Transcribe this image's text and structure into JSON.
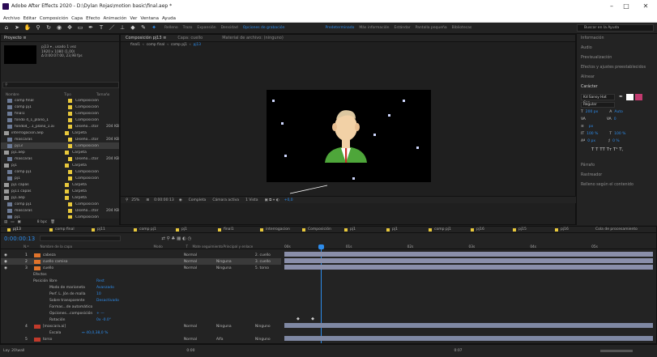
{
  "window": {
    "title": "Adobe After Effects 2020 - D:\\Dylan Rojas\\motion basic\\final.aep *",
    "minimize": "–",
    "maximize": "□",
    "close": "✕"
  },
  "menu": [
    "Archivo",
    "Editar",
    "Composición",
    "Capa",
    "Efecto",
    "Animación",
    "Ver",
    "Ventana",
    "Ayuda"
  ],
  "toolbar": {
    "items": [
      "Relleno",
      "Trazo",
      "Expansión",
      "Densidad",
      "Opciones de grabación",
      "Predeterminado",
      "Más información",
      "Estándar",
      "Pantalla pequeña",
      "Bibliotecas"
    ],
    "search_placeholder": "Buscar en la Ayuda"
  },
  "project": {
    "tab": "Proyecto ≡",
    "thumb_info": [
      "pj13 ▾ , usado 1 vez",
      "1920 x 1080 (1,00)",
      "Δ 0:00:07:00, 23,98 fps"
    ],
    "search_placeholder": "",
    "headers": [
      "Nombre",
      "Tipo",
      "Tamaño"
    ],
    "items": [
      {
        "name": "comp final",
        "type": "Composición",
        "size": "",
        "sel": false
      },
      {
        "name": "comp pj1",
        "type": "Composición",
        "size": "",
        "sel": false
      },
      {
        "name": "final1",
        "type": "Composición",
        "size": "",
        "sel": false
      },
      {
        "name": "fondo 4_1_plano_1",
        "type": "Composición",
        "size": "",
        "sel": false
      },
      {
        "name": "fondo4_..1_plano_1.ai",
        "type": "Diseño...ctor",
        "size": "204 KB",
        "sel": false
      },
      {
        "name": "interrogacion.aep",
        "type": "Carpeta",
        "size": "",
        "sel": false
      },
      {
        "name": "mascaras",
        "type": "Diseño...ctor",
        "size": "204 KB",
        "sel": false
      },
      {
        "name": "pj13",
        "type": "Composición",
        "size": "",
        "sel": true
      },
      {
        "name": "pj1.aep",
        "type": "Carpeta",
        "size": "",
        "sel": false
      },
      {
        "name": "mascaras",
        "type": "Diseño...ctor",
        "size": "204 KB",
        "sel": false
      },
      {
        "name": "pj1",
        "type": "Carpeta",
        "size": "",
        "sel": false
      },
      {
        "name": "comp pj1",
        "type": "Composición",
        "size": "",
        "sel": false
      },
      {
        "name": "pj1",
        "type": "Composición",
        "size": "",
        "sel": false
      },
      {
        "name": "pj1 capas",
        "type": "Carpeta",
        "size": "",
        "sel": false
      },
      {
        "name": "pj11 capas",
        "type": "Carpeta",
        "size": "",
        "sel": false
      },
      {
        "name": "pj1.aep",
        "type": "Carpeta",
        "size": "",
        "sel": false
      },
      {
        "name": "comp pj1",
        "type": "Composición",
        "size": "",
        "sel": false
      },
      {
        "name": "mascaras",
        "type": "Diseño...ctor",
        "size": "204 KB",
        "sel": false
      },
      {
        "name": "pj1",
        "type": "Composición",
        "size": "",
        "sel": false
      }
    ],
    "bit_depth": "8 bpc"
  },
  "composition": {
    "tab": "Composición pj13 ≡",
    "layer_tab": "Capa: cuello",
    "material": "Material de archivo: (ninguno)",
    "breadcrumbs": [
      "final1",
      "comp final",
      "comp pj1",
      "pj13"
    ],
    "zoom": "25%",
    "timecode": "0:00:00:13",
    "quality": "Completa",
    "camera": "Cámara activa",
    "views": "1 Vista",
    "offset": "+0,0"
  },
  "right_panel": {
    "items": [
      "Información",
      "Audio",
      "Previsualización",
      "Efectos y ajustes preestablecidos",
      "Alinear"
    ],
    "char_title": "Carácter",
    "font": "Kd Sansy Hat Con...",
    "style": "Regular",
    "size": "200 px",
    "leading": "Auto",
    "tracking": "0",
    "units": "px",
    "vscale": "100 %",
    "hscale": "100 %",
    "baseline": "0 px",
    "tsume": "0 %",
    "styles_text": "T  T  TT  Tт  T¹  T,",
    "after": [
      "Párrafo",
      "Rastreador",
      "Relleno según el contenido"
    ]
  },
  "timeline": {
    "tabs": [
      "pj13",
      "comp final",
      "pj11",
      "comp pj1",
      "pj1",
      "final1",
      "interrogacion",
      "Composición",
      "pj1",
      "pj1",
      "comp pj1",
      "pj16",
      "pj15",
      "pj16"
    ],
    "queue": "Cola de procesamiento",
    "timecode": "0:00:00:13",
    "columns": [
      "N.º",
      "Nombre de la capa",
      "Modo",
      "T",
      "Mate seguimiento",
      "Principal y enlace"
    ],
    "ruler": [
      "00s",
      "01s",
      "02s",
      "03s",
      "04s",
      "05s"
    ],
    "layers": [
      {
        "num": "1",
        "name": "cabeza",
        "mode": "Normal",
        "matte": "",
        "parent": "2. cuello"
      },
      {
        "num": "2",
        "name": "cuello camisa",
        "mode": "Normal",
        "matte": "Ninguna",
        "parent": "3. cuello"
      },
      {
        "num": "3",
        "name": "cuello",
        "mode": "Normal",
        "matte": "Ninguna",
        "parent": "5. torso"
      }
    ],
    "props": [
      {
        "label": "Efectos",
        "value": ""
      },
      {
        "label": "Posición libre",
        "value": "Rest"
      },
      {
        "label": "Modo de marioneta",
        "value": "Avanzado"
      },
      {
        "label": "Perf. L. Jón de malla",
        "value": "10"
      },
      {
        "label": "Sobre transparente",
        "value": "Desactivado"
      },
      {
        "label": "Formas...de automático",
        "value": ""
      },
      {
        "label": "Opciones...composición",
        "value": "+ —"
      },
      {
        "label": "Rotación",
        "value": "0x -0.0°"
      }
    ],
    "layer4": {
      "num": "4",
      "name": "[mascara.ai]",
      "mode": "Normal",
      "matte": "Ninguna",
      "parent": "Ninguno"
    },
    "scale": {
      "label": "Escala",
      "value": "↔ 40,0,38,0 %"
    },
    "layer5": {
      "num": "5",
      "name": "torso",
      "mode": "Normal",
      "matte": "Alfa",
      "parent": "Ninguno"
    },
    "time_label": "Tiempo de renderizado"
  },
  "status": {
    "left": "Lay. 20\\wall",
    "mid": "0:00",
    "right": "0:07"
  }
}
